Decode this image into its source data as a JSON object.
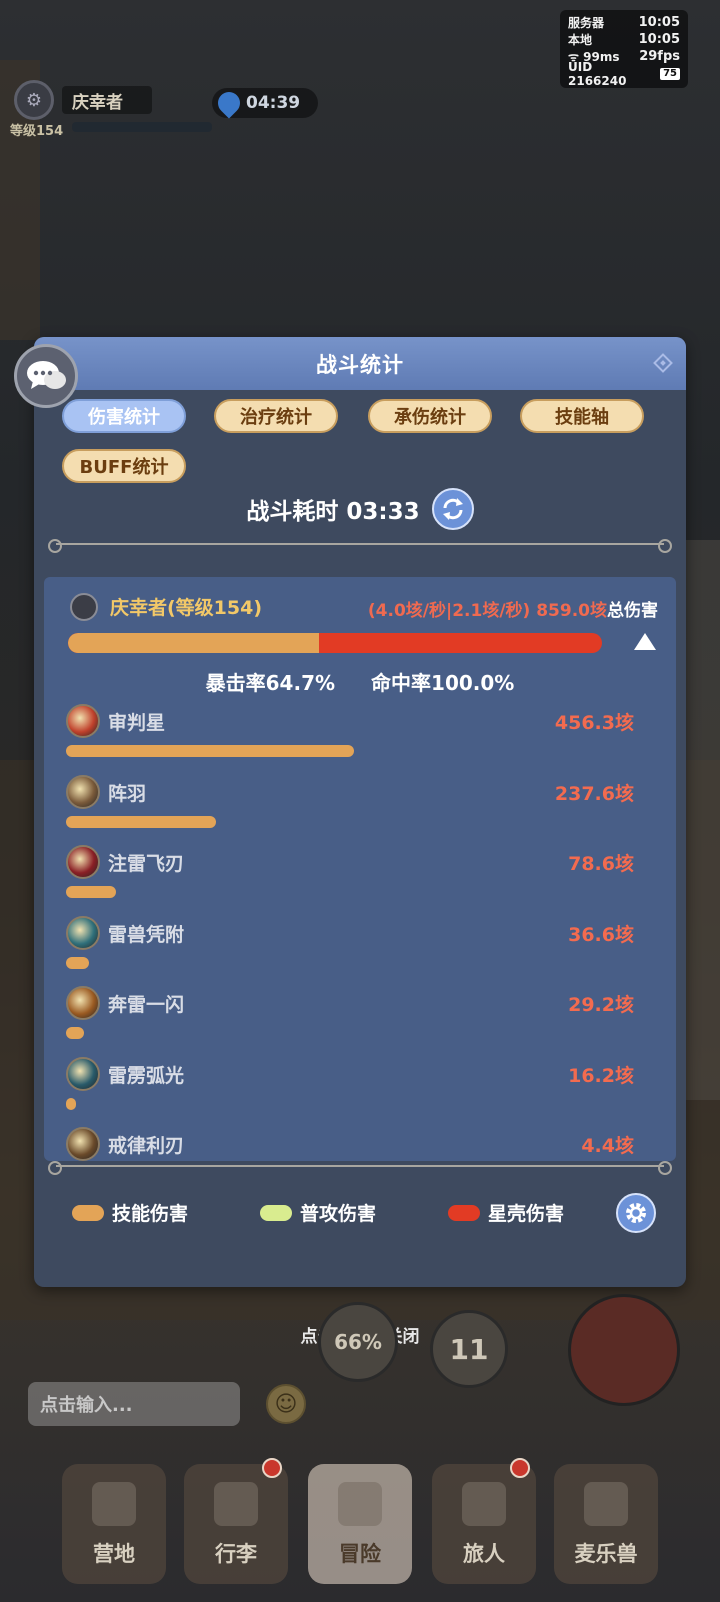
{
  "status": {
    "server_label": "服务器",
    "server_time": "10:05",
    "local_label": "本地",
    "local_time": "10:05",
    "ping": "99ms",
    "fps": "29fps",
    "uid": "UID 2166240",
    "battery": "75"
  },
  "player": {
    "name": "庆幸者",
    "level": "等级154"
  },
  "timer": "04:39",
  "panel": {
    "title": "战斗统计",
    "tabs": [
      {
        "label": "伤害统计",
        "active": true
      },
      {
        "label": "治疗统计",
        "active": false
      },
      {
        "label": "承伤统计",
        "active": false
      },
      {
        "label": "技能轴",
        "active": false
      },
      {
        "label": "BUFF统计",
        "active": false
      }
    ],
    "duration": "战斗耗时 03:33",
    "summary": {
      "name": "庆幸者(等级154)",
      "rates_red": "(4.0垓/秒|2.1垓/秒) 859.0垓",
      "total_label": "总伤害",
      "skill_fraction": 0.47,
      "crit": "暴击率64.7%",
      "hit": "命中率100.0%"
    },
    "skills": [
      {
        "name": "审判星",
        "value": "456.3垓",
        "amount": 456.3,
        "icon_color": "#c0412c"
      },
      {
        "name": "阵羽",
        "value": "237.6垓",
        "amount": 237.6,
        "icon_color": "#7a5a3a"
      },
      {
        "name": "注雷飞刃",
        "value": "78.6垓",
        "amount": 78.6,
        "icon_color": "#8a1f25"
      },
      {
        "name": "雷兽凭附",
        "value": "36.6垓",
        "amount": 36.6,
        "icon_color": "#2f6f7a"
      },
      {
        "name": "奔雷一闪",
        "value": "29.2垓",
        "amount": 29.2,
        "icon_color": "#9a5a22"
      },
      {
        "name": "雷雳弧光",
        "value": "16.2垓",
        "amount": 16.2,
        "icon_color": "#285a6a"
      },
      {
        "name": "戒律利刃",
        "value": "4.4垓",
        "amount": 4.4,
        "icon_color": "#6a4a2a"
      }
    ],
    "legend": [
      {
        "label": "技能伤害",
        "color": "#e3a457"
      },
      {
        "label": "普攻伤害",
        "color": "#d9ec8f"
      },
      {
        "label": "星壳伤害",
        "color": "#e23b24"
      }
    ]
  },
  "close_hint": "点击空白处关闭",
  "game_ui": {
    "orb_percent": "66%",
    "orb_count": "11",
    "chat_placeholder": "点击输入...",
    "nav": [
      {
        "label": "营地",
        "active": false,
        "badge": false
      },
      {
        "label": "行李",
        "active": false,
        "badge": true
      },
      {
        "label": "冒险",
        "active": true,
        "badge": false
      },
      {
        "label": "旅人",
        "active": false,
        "badge": true
      },
      {
        "label": "麦乐兽",
        "active": false,
        "badge": false
      }
    ]
  }
}
